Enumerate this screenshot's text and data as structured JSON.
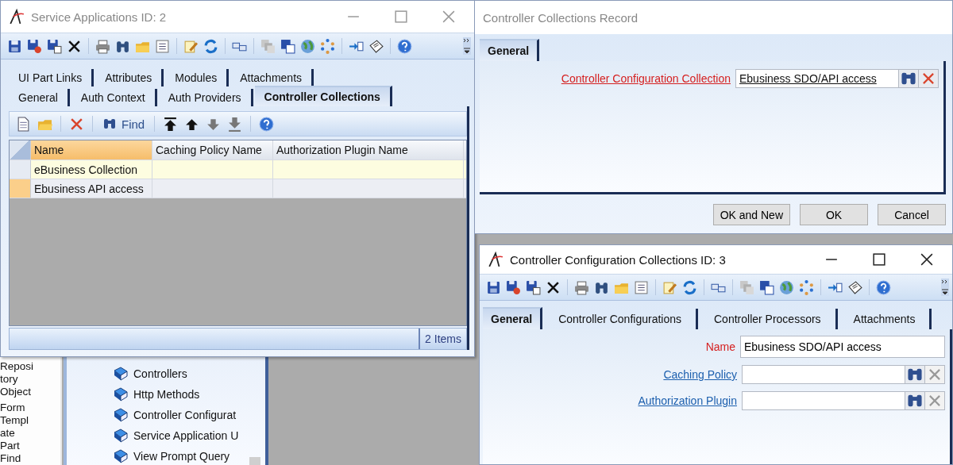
{
  "background": {
    "sidebar_items": [
      "Reposi",
      "tory",
      "Object",
      "Form",
      "Templ",
      "ate",
      "Part",
      "Find"
    ],
    "tree_items": [
      "Controllers",
      "Http Methods",
      "Controller Configurat",
      "Service Application U",
      "View Prompt Query"
    ]
  },
  "service_window": {
    "title": "Service Applications ID: 2",
    "active": false,
    "tab_rows": [
      [
        {
          "label": "UI Part Links",
          "selected": false
        },
        {
          "label": "Attributes",
          "selected": false
        },
        {
          "label": "Modules",
          "selected": false
        },
        {
          "label": "Attachments",
          "selected": false
        }
      ],
      [
        {
          "label": "General",
          "selected": false
        },
        {
          "label": "Auth Context",
          "selected": false
        },
        {
          "label": "Auth Providers",
          "selected": false
        },
        {
          "label": "Controller Collections",
          "selected": true
        }
      ]
    ],
    "find_label": "Find",
    "table": {
      "columns": [
        {
          "label": "Name",
          "sorted": true
        },
        {
          "label": "Caching Policy Name",
          "sorted": false
        },
        {
          "label": "Authorization Plugin Name",
          "sorted": false
        }
      ],
      "rows": [
        {
          "cells": [
            "eBusiness Collection",
            null,
            null
          ],
          "highlighted": true,
          "selected": false
        },
        {
          "cells": [
            "Ebusiness API access",
            null,
            null
          ],
          "highlighted": false,
          "selected": true
        }
      ]
    },
    "status": "2 Items"
  },
  "record_dialog": {
    "title": "Controller Collections Record",
    "active": false,
    "tabs": [
      {
        "label": "General",
        "selected": true
      }
    ],
    "fields": [
      {
        "kind": "lookup",
        "label": "Controller Configuration Collection",
        "required": true,
        "value": "Ebusiness SDO/API access",
        "clear_disabled": false
      }
    ],
    "buttons": [
      "OK and New",
      "OK",
      "Cancel"
    ]
  },
  "config_window": {
    "title": "Controller Configuration Collections ID: 3",
    "active": true,
    "tabs": [
      {
        "label": "General",
        "selected": true
      },
      {
        "label": "Controller Configurations",
        "selected": false
      },
      {
        "label": "Controller Processors",
        "selected": false
      },
      {
        "label": "Attachments",
        "selected": false
      }
    ],
    "fields": [
      {
        "kind": "text",
        "label": "Name",
        "required": true,
        "value": "Ebusiness SDO/API access"
      },
      {
        "kind": "lookup",
        "label": "Caching Policy",
        "required": false,
        "clear_disabled": true
      },
      {
        "kind": "lookup",
        "label": "Authorization Plugin",
        "required": false,
        "clear_disabled": true
      }
    ]
  }
}
